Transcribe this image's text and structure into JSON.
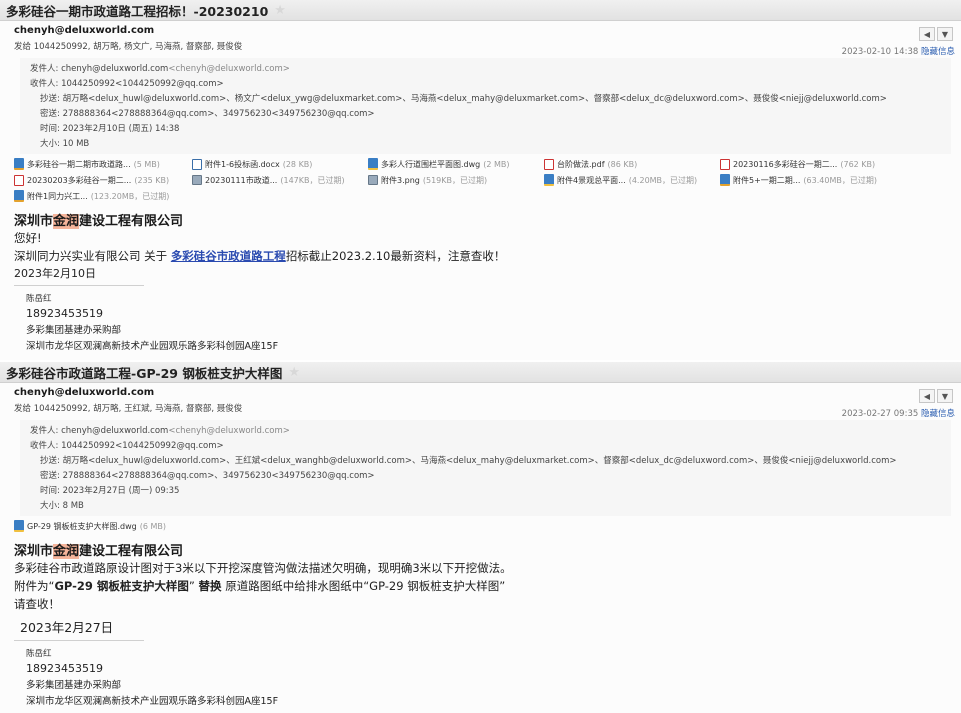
{
  "email1": {
    "subject": "多彩硅谷一期市政道路工程招标！-20230210",
    "sender": "chenyh@deluxworld.com",
    "to_line": "发给 1044250992, 胡万略, 杨文广, 马海燕, 督察部, 聂俊俊",
    "datetime": "2023-02-10 14:38",
    "hide_label": "隐藏信息",
    "details": {
      "from_label": "发件人:",
      "from_name": "chenyh@deluxworld.com",
      "from_addr": "<chenyh@deluxworld.com>",
      "to_label": "收件人:",
      "to_value": "1044250992<1044250992@qq.com>",
      "cc_label": "抄送:",
      "cc_value": "胡万略<delux_huwl@deluxworld.com>、杨文广<delux_ywg@deluxmarket.com>、马海燕<delux_mahy@deluxmarket.com>、督察部<delux_dc@deluxword.com>、聂俊俊<niejj@deluxworld.com>",
      "bcc_label": "密送:",
      "bcc_value": "278888364<278888364@qq.com>、349756230<349756230@qq.com>",
      "time_label": "时间:",
      "time_value": "2023年2月10日 (周五) 14:38",
      "size_label": "大小:",
      "size_value": "10 MB"
    },
    "attachments": [
      {
        "icon": "zip",
        "name": "多彩硅谷一期二期市政道路...",
        "size": "(5 MB)"
      },
      {
        "icon": "doc",
        "name": "附件1-6投标函.docx",
        "size": "(28 KB)"
      },
      {
        "icon": "dwg",
        "name": "多彩人行道围栏平面图.dwg",
        "size": "(2 MB)"
      },
      {
        "icon": "pdf",
        "name": "台阶做法.pdf",
        "size": "(86 KB)"
      },
      {
        "icon": "pdf",
        "name": "20230116多彩硅谷一期二...",
        "size": "(762 KB)"
      },
      {
        "icon": "pdf",
        "name": "20230203多彩硅谷一期二...",
        "size": "(235 KB)"
      },
      {
        "icon": "img",
        "name": "20230111市政道...",
        "size": "(147KB，已过期)"
      },
      {
        "icon": "img",
        "name": "附件3.png",
        "size": "(519KB，已过期)"
      },
      {
        "icon": "dwg",
        "name": "附件4景观总平面...",
        "size": "(4.20MB，已过期)"
      },
      {
        "icon": "zip",
        "name": "附件5+一期二期...",
        "size": "(63.40MB，已过期)"
      },
      {
        "icon": "zip",
        "name": "附件1同力兴工...",
        "size": "(123.20MB，已过期)"
      }
    ],
    "company_a": "深圳市",
    "company_hl": "金润",
    "company_b": "建设工程有限公司",
    "greeting": "您好!",
    "msg_prefix": "深圳同力兴实业有限公司 关于 ",
    "msg_link": "多彩硅谷市政道路工程",
    "msg_suffix": "招标截止2023.2.10最新资料，注意查收！",
    "date_line": "2023年2月10日",
    "sig_name": "陈岳红",
    "sig_phone": "18923453519",
    "sig_dept": "多彩集团基建办采购部",
    "sig_addr": "深圳市龙华区观澜高新技术产业园观乐路多彩科创园A座15F"
  },
  "email2": {
    "subject": "多彩硅谷市政道路工程-GP-29 钢板桩支护大样图",
    "sender": "chenyh@deluxworld.com",
    "to_line": "发给 1044250992, 胡万略, 王红斌, 马海燕, 督察部, 聂俊俊",
    "datetime": "2023-02-27 09:35",
    "hide_label": "隐藏信息",
    "details": {
      "from_label": "发件人:",
      "from_name": "chenyh@deluxworld.com",
      "from_addr": "<chenyh@deluxworld.com>",
      "to_label": "收件人:",
      "to_value": "1044250992<1044250992@qq.com>",
      "cc_label": "抄送:",
      "cc_value": "胡万略<delux_huwl@deluxworld.com>、王红斌<delux_wanghb@deluxworld.com>、马海燕<delux_mahy@deluxmarket.com>、督察部<delux_dc@deluxword.com>、聂俊俊<niejj@deluxworld.com>",
      "bcc_label": "密送:",
      "bcc_value": "278888364<278888364@qq.com>、349756230<349756230@qq.com>",
      "time_label": "时间:",
      "time_value": "2023年2月27日 (周一) 09:35",
      "size_label": "大小:",
      "size_value": "8 MB"
    },
    "attachment": {
      "icon": "dwg",
      "name": "GP-29 钢板桩支护大样图.dwg",
      "size": "(6 MB)"
    },
    "company_a": "深圳市",
    "company_hl": "金润",
    "company_b": "建设工程有限公司",
    "line1": "多彩硅谷市政道路原设计图对于3米以下开挖深度管沟做法描述欠明确，现明确3米以下开挖做法。",
    "line2_a": " 附件为“",
    "line2_b": "GP-29 钢板桩支护大样图",
    "line2_c": "” ",
    "line2_d": "替换",
    "line2_e": " 原道路图纸中给排水图纸中“GP-29 钢板桩支护大样图”",
    "line3": "请查收！",
    "date_line": "2023年2月27日",
    "sig_name": "陈岳红",
    "sig_phone": "18923453519",
    "sig_dept": "多彩集团基建办采购部",
    "sig_addr": "深圳市龙华区观澜高新技术产业园观乐路多彩科创园A座15F"
  },
  "icons": {
    "star": "star-icon",
    "prev": "prev-arrow-icon",
    "next": "dropdown-arrow-icon"
  }
}
